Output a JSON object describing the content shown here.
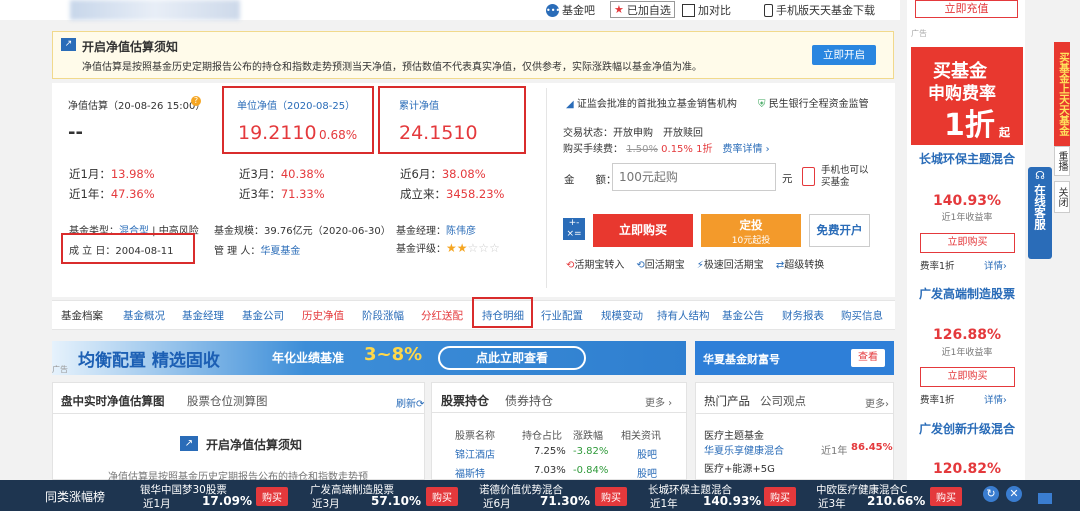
{
  "topbar": {
    "fund_bar": "基金吧",
    "added_watch": "已加自选",
    "compare": "加对比",
    "mobile": "手机版天天基金下载"
  },
  "notice": {
    "title": "开启净值估算须知",
    "text": "净值估算是按照基金历史定期报告公布的持仓和指数走势预测当天净值，预估数值不代表真实净值，仅供参考，实际涨跌幅以基金净值为准。",
    "button": "立即开启"
  },
  "nav": {
    "est_label": "净值估算（20-08-26 15:00）",
    "est_value": "--",
    "unit_label": "单位净值（2020-08-25）",
    "unit_value": "19.2110",
    "unit_change": "0.68%",
    "acc_label": "累计净值",
    "acc_value": "24.1510",
    "perf": [
      {
        "label": "近1月：",
        "value": "13.98%"
      },
      {
        "label": "近3月：",
        "value": "40.38%"
      },
      {
        "label": "近6月：",
        "value": "38.08%"
      },
      {
        "label": "近1年：",
        "value": "47.36%"
      },
      {
        "label": "近3年：",
        "value": "71.33%"
      },
      {
        "label": "成立来：",
        "value": "3458.23%"
      }
    ],
    "type_label": "基金类型：",
    "type_value": "混合型",
    "risk": "中高风险",
    "scale_label": "基金规模：",
    "scale_value": "39.76亿元（2020-06-30）",
    "manager_label": "基金经理：",
    "manager_value": "陈伟彦",
    "found_label": "成 立 日：",
    "found_value": "2004-08-11",
    "admin_label": "管 理 人：",
    "admin_value": "华夏基金",
    "rating_label": "基金评级：",
    "rating": 2
  },
  "trade": {
    "csrc": "证监会批准的首批独立基金销售机构",
    "bank": "民生银行全程资金监管",
    "status_label": "交易状态：",
    "status_value": "开放申购　开放赎回",
    "fee_label": "购买手续费：",
    "fee_old": "1.50%",
    "fee_new": "0.15%",
    "fee_discount": "1折",
    "fee_detail": "费率详情",
    "amount_label": "金　　额：",
    "amount_placeholder": "100元起购",
    "unit": "元",
    "mobile_hint": "手机也可以买基金",
    "buy": "立即购买",
    "fixed": "定投",
    "fixed_sub": "10元起投",
    "open_account": "免费开户",
    "links": [
      "活期宝转入",
      "回活期宝",
      "极速回活期宝",
      "超级转换"
    ]
  },
  "tabs": [
    "基金档案",
    "基金概况",
    "基金经理",
    "基金公司",
    "历史净值",
    "阶段涨幅",
    "分红送配",
    "持仓明细",
    "行业配置",
    "规模变动",
    "持有人结构",
    "基金公告",
    "财务报表",
    "购买信息"
  ],
  "banner": {
    "title": "均衡配置 精选固收",
    "sub": "年化业绩基准",
    "range": "3~8%",
    "cta": "点此立即查看",
    "ad": "广告",
    "right_title": "华夏基金财富号",
    "right_btn": "查看"
  },
  "panel1": {
    "tab1": "盘中实时净值估算图",
    "tab2": "股票仓位测算图",
    "refresh": "刷新",
    "overlay": "开启净值估算须知",
    "overlay_text": "净值估算是按照基金历史定期报告公布的持仓和指数走势预"
  },
  "panel2": {
    "tab1": "股票持仓",
    "tab2": "债券持仓",
    "more": "更多",
    "headers": [
      "股票名称",
      "持仓占比",
      "涨跌幅",
      "相关资讯"
    ],
    "rows": [
      {
        "name": "锦江酒店",
        "pct": "7.25%",
        "chg": "-3.82%",
        "link": "股吧"
      },
      {
        "name": "福斯特",
        "pct": "7.03%",
        "chg": "-0.84%",
        "link": "股吧"
      }
    ]
  },
  "panel3": {
    "tab1": "热门产品",
    "tab2": "公司观点",
    "more": "更多",
    "cat1": "医疗主题基金",
    "fund1": "华夏乐享健康混合",
    "fund1_label": "近1年",
    "fund1_value": "86.45%",
    "cat2": "医疗+能源+5G"
  },
  "rightcol": {
    "top_btn": "立即充值",
    "ad_label": "广告",
    "ad_title": "买基金",
    "ad_sub": "申购费率",
    "ad_big": "1折",
    "ad_small": "起",
    "funds": [
      {
        "name": "长城环保主题混合",
        "value": "140.93%",
        "sub": "近1年收益率",
        "btn": "立即购买",
        "fee": "费率1折",
        "detail": "详情"
      },
      {
        "name": "广发高端制造股票",
        "value": "126.88%",
        "sub": "近1年收益率",
        "btn": "立即购买",
        "fee": "费率1折",
        "detail": "详情"
      },
      {
        "name": "广发创新升级混合",
        "value": "120.82%",
        "sub": "",
        "btn": "",
        "fee": "",
        "detail": ""
      }
    ]
  },
  "sidetabs": {
    "red": "买基金上天天基金",
    "replay": "重播",
    "close": "关闭",
    "service": "在线客服"
  },
  "bottom": {
    "title": "同类涨幅榜",
    "items": [
      {
        "name": "银华中国梦30股票",
        "period": "近1月",
        "value": "17.09%",
        "btn": "购买"
      },
      {
        "name": "广发高端制造股票",
        "period": "近3月",
        "value": "57.10%",
        "btn": "购买"
      },
      {
        "name": "诺德价值优势混合",
        "period": "近6月",
        "value": "71.30%",
        "btn": "购买"
      },
      {
        "name": "长城环保主题混合",
        "period": "近1年",
        "value": "140.93%",
        "btn": "购买"
      },
      {
        "name": "中欧医疗健康混合C",
        "period": "近3年",
        "value": "210.66%",
        "btn": "购买"
      }
    ]
  }
}
